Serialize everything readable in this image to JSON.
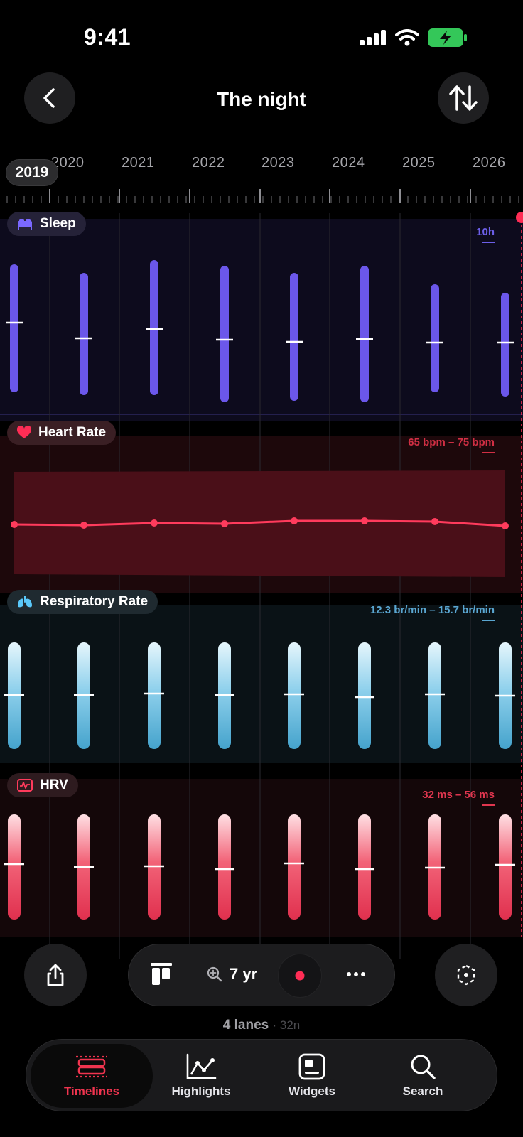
{
  "status": {
    "time": "9:41"
  },
  "header": {
    "title": "The night",
    "back_icon": "chevron-left-icon",
    "sort_icon": "swap-vertical-icon"
  },
  "timeline": {
    "current_year": "2019",
    "years": [
      "2020",
      "2021",
      "2022",
      "2023",
      "2024",
      "2025",
      "2026"
    ]
  },
  "lanes": [
    {
      "key": "sleep",
      "label": "Sleep",
      "icon": "bed-icon",
      "range": "10h",
      "color": "#6b57ea",
      "accent": "#5b4de0"
    },
    {
      "key": "heart",
      "label": "Heart Rate",
      "icon": "heart-icon",
      "range": "65 bpm – 75 bpm",
      "color": "#ff2d55",
      "accent": "#d3293f"
    },
    {
      "key": "resp",
      "label": "Respiratory Rate",
      "icon": "lungs-icon",
      "range": "12.3 br/min – 15.7 br/min",
      "color": "#5ac8fa",
      "accent": "#58a9d3"
    },
    {
      "key": "hrv",
      "label": "HRV",
      "icon": "waveform-icon",
      "range": "32 ms – 56 ms",
      "color": "#ff3b5c",
      "accent": "#e0364f"
    }
  ],
  "toolbar": {
    "zoom": "7 yr"
  },
  "footer": {
    "lanes_count": "4 lanes",
    "nights": "· 32n"
  },
  "tabs": [
    {
      "label": "Timelines",
      "icon": "timelines-icon"
    },
    {
      "label": "Highlights",
      "icon": "chart-line-icon"
    },
    {
      "label": "Widgets",
      "icon": "widgets-icon"
    },
    {
      "label": "Search",
      "icon": "search-icon"
    }
  ],
  "colors": {
    "background": "#000000",
    "active_tab": "#f0344f"
  }
}
